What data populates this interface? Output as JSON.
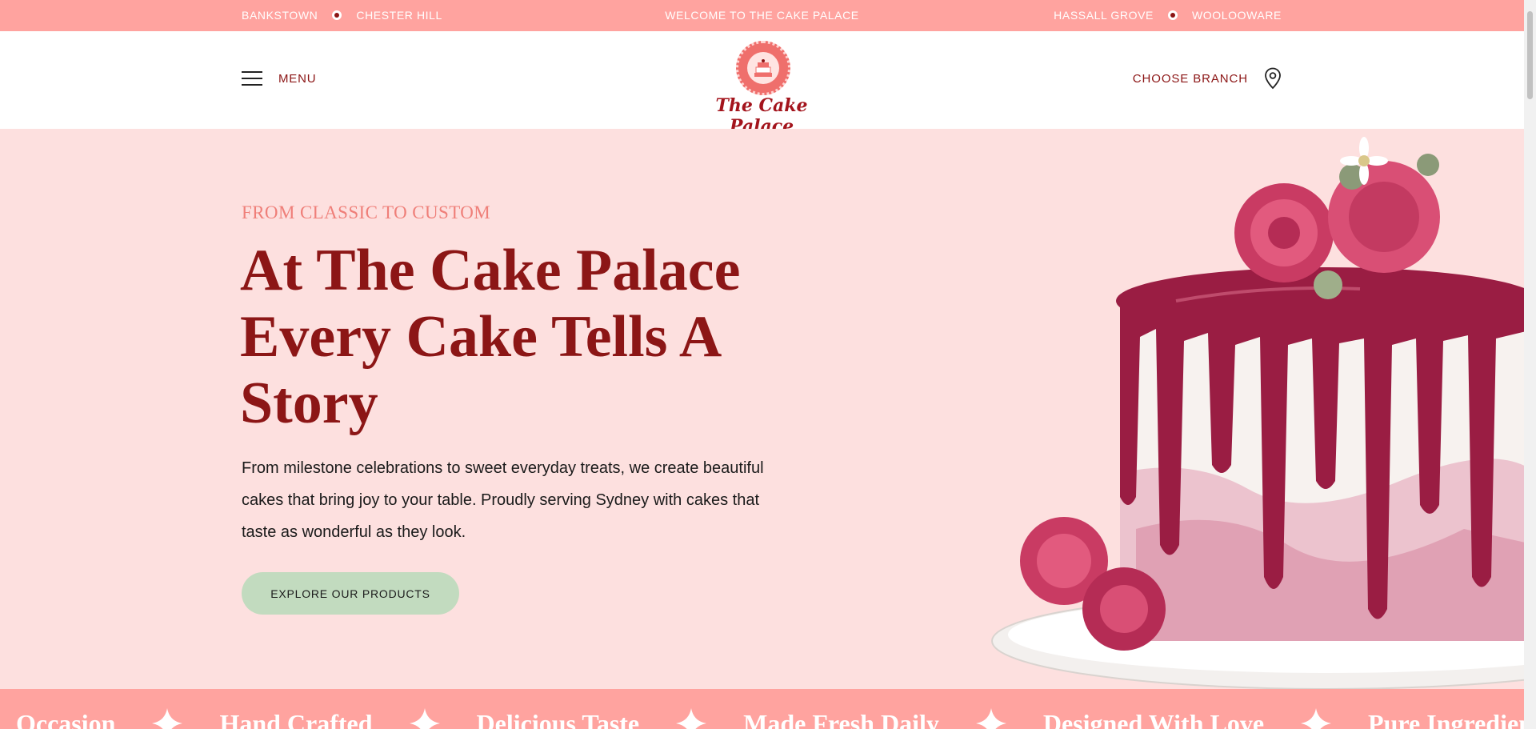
{
  "topbar": {
    "left_locations": [
      "BANKSTOWN",
      "CHESTER HILL"
    ],
    "welcome": "WELCOME TO THE CAKE PALACE",
    "right_locations": [
      "HASSALL GROVE",
      "WOOLOOWARE"
    ]
  },
  "header": {
    "menu_label": "MENU",
    "logo_text": "The Cake Palace",
    "branch_label": "CHOOSE BRANCH"
  },
  "hero": {
    "eyebrow": "FROM CLASSIC TO CUSTOM",
    "headline": "At The Cake Palace Every Cake Tells A Story",
    "lead": "From milestone celebrations to sweet everyday treats, we create beautiful cakes that bring joy to your table. Proudly serving Sydney with cakes that taste as wonderful as they look.",
    "cta_label": "EXPLORE OUR PRODUCTS"
  },
  "marquee": {
    "items": [
      "Occasion",
      "Hand Crafted",
      "Delicious Taste",
      "Made Fresh Daily",
      "Designed With Love",
      "Pure Ingredients"
    ]
  },
  "icons": {
    "menu": "hamburger-icon",
    "branch": "map-pin-icon",
    "separator": "star-icon"
  },
  "colors": {
    "topbar": "#ffa39f",
    "hero_bg": "#fde0df",
    "brand_red": "#8c1616",
    "accent_pink": "#ef7f79",
    "cta_green": "#c2dbbf"
  }
}
